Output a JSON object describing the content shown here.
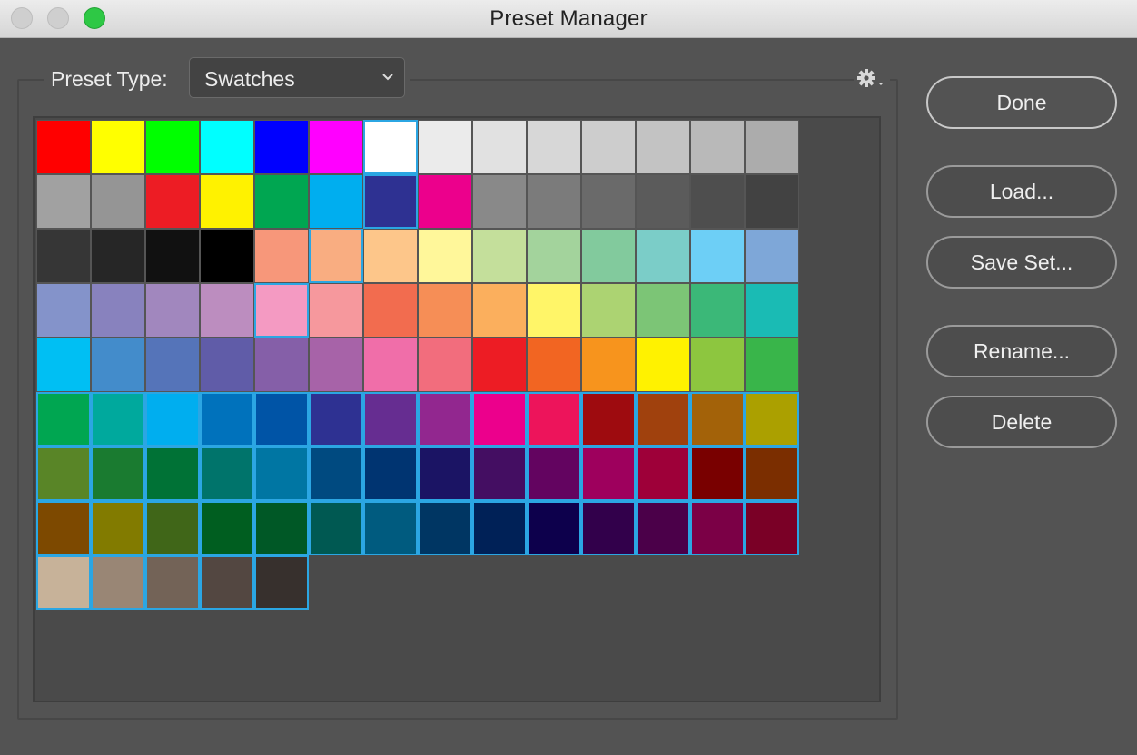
{
  "window": {
    "title": "Preset Manager"
  },
  "preset": {
    "label": "Preset Type:",
    "selected": "Swatches"
  },
  "buttons": {
    "done": "Done",
    "load": "Load...",
    "save_set": "Save Set...",
    "rename": "Rename...",
    "delete": "Delete"
  },
  "colors": {
    "accent_selection": "#2ba6e3",
    "background": "#535353"
  },
  "swatches": [
    {
      "c": "#ff0000",
      "s": false
    },
    {
      "c": "#ffff00",
      "s": false
    },
    {
      "c": "#00ff00",
      "s": false
    },
    {
      "c": "#00ffff",
      "s": false
    },
    {
      "c": "#0000ff",
      "s": false
    },
    {
      "c": "#ff00ff",
      "s": false
    },
    {
      "c": "#ffffff",
      "s": true
    },
    {
      "c": "#ebebeb",
      "s": false
    },
    {
      "c": "#e1e1e1",
      "s": false
    },
    {
      "c": "#d7d7d7",
      "s": false
    },
    {
      "c": "#cdcdcd",
      "s": false
    },
    {
      "c": "#c3c3c3",
      "s": false
    },
    {
      "c": "#b9b9b9",
      "s": false
    },
    {
      "c": "#acacac",
      "s": false
    },
    {
      "c": "#a1a1a1",
      "s": false
    },
    {
      "c": "#959595",
      "s": false
    },
    {
      "c": "#ed1c24",
      "s": false
    },
    {
      "c": "#fff200",
      "s": false
    },
    {
      "c": "#00a651",
      "s": false
    },
    {
      "c": "#00aeef",
      "s": false
    },
    {
      "c": "#2e3192",
      "s": true
    },
    {
      "c": "#ec008c",
      "s": false
    },
    {
      "c": "#898989",
      "s": false
    },
    {
      "c": "#7b7b7b",
      "s": false
    },
    {
      "c": "#6a6a6a",
      "s": false
    },
    {
      "c": "#5b5b5b",
      "s": false
    },
    {
      "c": "#4e4e4e",
      "s": false
    },
    {
      "c": "#424242",
      "s": false
    },
    {
      "c": "#363636",
      "s": false
    },
    {
      "c": "#262626",
      "s": false
    },
    {
      "c": "#111111",
      "s": false
    },
    {
      "c": "#000000",
      "s": false
    },
    {
      "c": "#f7977a",
      "s": false
    },
    {
      "c": "#f9ad81",
      "s": true
    },
    {
      "c": "#fdc68a",
      "s": false
    },
    {
      "c": "#fff79a",
      "s": false
    },
    {
      "c": "#c4df9b",
      "s": false
    },
    {
      "c": "#a3d39c",
      "s": false
    },
    {
      "c": "#82ca9d",
      "s": false
    },
    {
      "c": "#7bcdc8",
      "s": false
    },
    {
      "c": "#6dcff6",
      "s": false
    },
    {
      "c": "#7ea7d8",
      "s": false
    },
    {
      "c": "#8493ca",
      "s": false
    },
    {
      "c": "#8882be",
      "s": false
    },
    {
      "c": "#a187be",
      "s": false
    },
    {
      "c": "#bc8dbf",
      "s": false
    },
    {
      "c": "#f49ac2",
      "s": true
    },
    {
      "c": "#f6989d",
      "s": false
    },
    {
      "c": "#f26c4f",
      "s": false
    },
    {
      "c": "#f68e56",
      "s": false
    },
    {
      "c": "#fbaf5d",
      "s": false
    },
    {
      "c": "#fff568",
      "s": false
    },
    {
      "c": "#acd372",
      "s": false
    },
    {
      "c": "#7cc576",
      "s": false
    },
    {
      "c": "#3bb878",
      "s": false
    },
    {
      "c": "#1abbb4",
      "s": false
    },
    {
      "c": "#00bff3",
      "s": false
    },
    {
      "c": "#438ccb",
      "s": false
    },
    {
      "c": "#5574b9",
      "s": false
    },
    {
      "c": "#605ca8",
      "s": false
    },
    {
      "c": "#855fa8",
      "s": false
    },
    {
      "c": "#a763a8",
      "s": false
    },
    {
      "c": "#f06ea9",
      "s": false
    },
    {
      "c": "#f26d7d",
      "s": false
    },
    {
      "c": "#ed1c24",
      "s": false
    },
    {
      "c": "#f26522",
      "s": false
    },
    {
      "c": "#f7941d",
      "s": false
    },
    {
      "c": "#fff200",
      "s": false
    },
    {
      "c": "#8dc63f",
      "s": false
    },
    {
      "c": "#39b54a",
      "s": false
    },
    {
      "c": "#00a651",
      "s": true
    },
    {
      "c": "#00a99d",
      "s": true
    },
    {
      "c": "#00aeef",
      "s": true
    },
    {
      "c": "#0072bc",
      "s": true
    },
    {
      "c": "#0054a6",
      "s": true
    },
    {
      "c": "#2e3192",
      "s": true
    },
    {
      "c": "#662d91",
      "s": true
    },
    {
      "c": "#92278f",
      "s": true
    },
    {
      "c": "#ec008c",
      "s": true
    },
    {
      "c": "#ed145b",
      "s": true
    },
    {
      "c": "#9e0b0f",
      "s": true
    },
    {
      "c": "#a0410d",
      "s": true
    },
    {
      "c": "#a36209",
      "s": true
    },
    {
      "c": "#aba000",
      "s": true
    },
    {
      "c": "#598527",
      "s": true
    },
    {
      "c": "#1a7b30",
      "s": true
    },
    {
      "c": "#007236",
      "s": true
    },
    {
      "c": "#00746b",
      "s": true
    },
    {
      "c": "#0076a3",
      "s": true
    },
    {
      "c": "#004a80",
      "s": true
    },
    {
      "c": "#003471",
      "s": true
    },
    {
      "c": "#1b1464",
      "s": true
    },
    {
      "c": "#440e62",
      "s": true
    },
    {
      "c": "#630460",
      "s": true
    },
    {
      "c": "#9e005d",
      "s": true
    },
    {
      "c": "#9e0039",
      "s": true
    },
    {
      "c": "#790000",
      "s": true
    },
    {
      "c": "#7b2e00",
      "s": true
    },
    {
      "c": "#7d4900",
      "s": true
    },
    {
      "c": "#827b00",
      "s": true
    },
    {
      "c": "#406618",
      "s": true
    },
    {
      "c": "#005e20",
      "s": true
    },
    {
      "c": "#005826",
      "s": true
    },
    {
      "c": "#005952",
      "s": true
    },
    {
      "c": "#005b7f",
      "s": true
    },
    {
      "c": "#003663",
      "s": true
    },
    {
      "c": "#002157",
      "s": true
    },
    {
      "c": "#0d004c",
      "s": true
    },
    {
      "c": "#32004b",
      "s": true
    },
    {
      "c": "#4b0049",
      "s": true
    },
    {
      "c": "#7b0046",
      "s": true
    },
    {
      "c": "#7a0026",
      "s": true
    },
    {
      "c": "#c7b299",
      "s": true
    },
    {
      "c": "#998675",
      "s": true
    },
    {
      "c": "#736357",
      "s": true
    },
    {
      "c": "#534741",
      "s": true
    },
    {
      "c": "#37302d",
      "s": true
    }
  ]
}
